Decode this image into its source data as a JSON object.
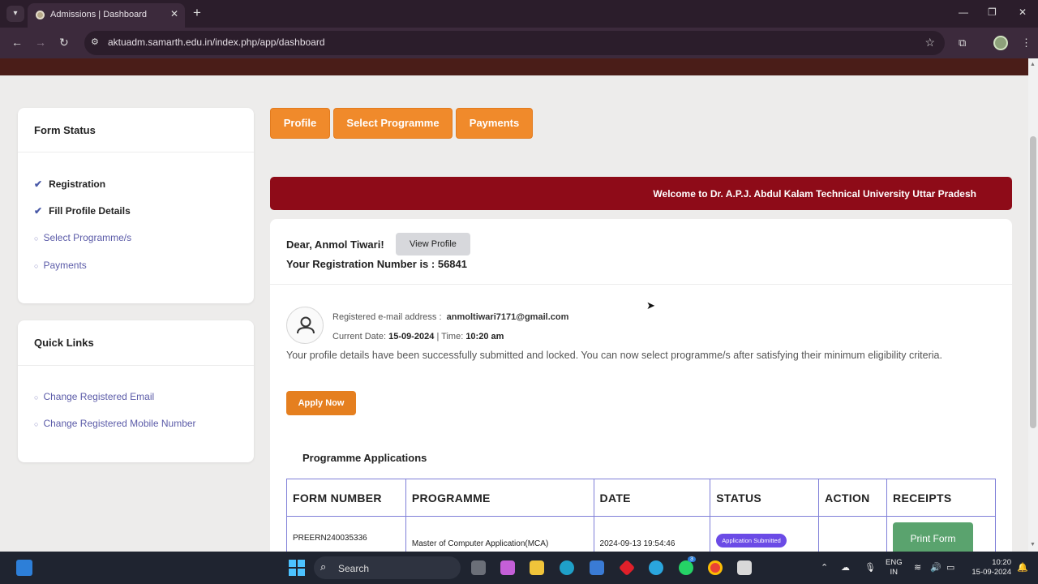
{
  "browser": {
    "tab_title": "Admissions | Dashboard",
    "url": "aktuadm.samarth.edu.in/index.php/app/dashboard"
  },
  "form_status": {
    "title": "Form Status",
    "items": [
      {
        "label": "Registration",
        "state": "done"
      },
      {
        "label": "Fill Profile Details",
        "state": "done"
      },
      {
        "label": "Select Programme/s",
        "state": "pending"
      },
      {
        "label": "Payments",
        "state": "pending"
      }
    ]
  },
  "quick_links": {
    "title": "Quick Links",
    "items": [
      "Change Registered Email",
      "Change Registered Mobile Number"
    ]
  },
  "top_nav": {
    "buttons": [
      "Profile",
      "Select Programme",
      "Payments"
    ]
  },
  "welcome_text": "Welcome to Dr. A.P.J. Abdul Kalam Technical University Uttar Pradesh",
  "profile": {
    "greeting": "Dear, Anmol Tiwari!",
    "view_profile_label": "View Profile",
    "registration_line": "Your Registration Number is : 56841",
    "email_label": "Registered e-mail address :",
    "email": "anmoltiwari7171@gmail.com",
    "date_label": "Current Date:",
    "date": "15-09-2024",
    "time_label": "| Time:",
    "time": "10:20 am",
    "message": "Your profile details have been successfully submitted and locked. You can now select programme/s after satisfying their minimum eligibility criteria.",
    "apply_label": "Apply Now"
  },
  "applications": {
    "title": "Programme Applications",
    "columns": [
      "FORM NUMBER",
      "PROGRAMME",
      "DATE",
      "STATUS",
      "ACTION",
      "RECEIPTS"
    ],
    "rows": [
      {
        "form_number": "PREERN240035336",
        "programme": "Master of Computer Application(MCA)",
        "date": "2024-09-13 19:54:46",
        "status": "Application Submitted",
        "action": "",
        "receipt_label": "Print Form"
      }
    ]
  },
  "taskbar": {
    "search_placeholder": "Search",
    "lang_top": "ENG",
    "lang_bottom": "IN",
    "time": "10:20",
    "date": "15-09-2024",
    "notification_count": "3"
  },
  "colors": {
    "accent_orange": "#f08a2b",
    "welcome_red": "#8e0b18",
    "link_purple": "#5b5ba8",
    "badge_purple": "#6b4be6",
    "print_green": "#5aa36e"
  }
}
